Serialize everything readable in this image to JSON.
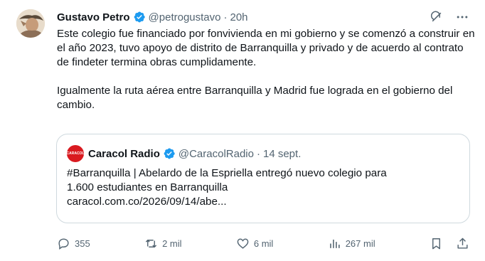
{
  "author": {
    "name": "Gustavo Petro",
    "handle": "@petrogustavo",
    "separator": "·",
    "time": "20h"
  },
  "body": {
    "paragraph1": "Este colegio fue financiado por fonvivienda en mi gobierno y se comenzó a construir en el año  2023, tuvo apoyo de distrito de Barranquilla y privado y de acuerdo al contrato de findeter termina obras cumplidamente.",
    "paragraph2": "Igualmente la ruta aérea entre Barranquilla y Madrid  fue lograda en el gobierno del cambio."
  },
  "quote": {
    "name": "Caracol Radio",
    "handle": "@CaracolRadio",
    "separator": "·",
    "date": "14 sept.",
    "logo_text": "CARACOL",
    "line1": "#Barranquilla | Abelardo de la Espriella entregó nuevo colegio para",
    "line2": "1.600 estudiantes en Barranquilla",
    "line3": "caracol.com.co/2026/09/14/abe..."
  },
  "actions": {
    "replies": "355",
    "reposts": "2 mil",
    "likes": "6 mil",
    "views": "267 mil"
  },
  "colors": {
    "verified": "#1d9bf0",
    "secondary_text": "#536471",
    "border": "#cfd9de",
    "caracol_red": "#d91a20"
  },
  "icons": [
    "grok-icon",
    "more-icon",
    "verified-badge-icon",
    "reply-icon",
    "repost-icon",
    "like-icon",
    "views-icon",
    "bookmark-icon",
    "share-icon"
  ]
}
